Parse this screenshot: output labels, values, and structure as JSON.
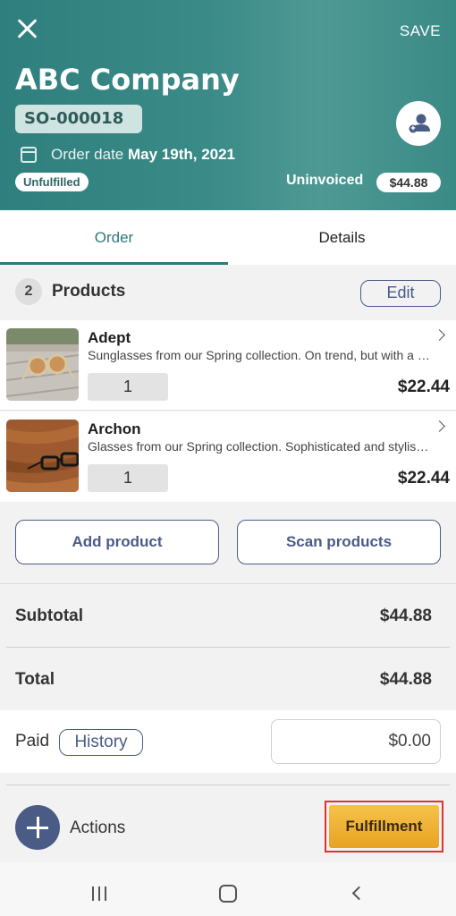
{
  "header": {
    "company": "ABC Company",
    "order_number": "SO-000018",
    "order_date_label": "Order date",
    "order_date_value": "May 19th, 2021",
    "status_badge": "Unfulfilled",
    "invoice_status": "Uninvoiced",
    "invoice_amount": "$44.88",
    "save_label": "SAVE"
  },
  "tabs": [
    {
      "label": "Order",
      "active": true
    },
    {
      "label": "Details",
      "active": false
    }
  ],
  "products_section": {
    "count": "2",
    "title": "Products",
    "edit_label": "Edit"
  },
  "products": [
    {
      "name": "Adept",
      "description": "Sunglasses from our Spring collection. On trend, but with a classic silhouette.",
      "quantity": "1",
      "price": "$22.44",
      "thumbnail": "round-sunglasses-on-wooden-deck"
    },
    {
      "name": "Archon",
      "description": "Glasses from our Spring collection. Sophisticated and stylish frames.",
      "quantity": "1",
      "price": "$22.44",
      "thumbnail": "black-glasses-on-wooden-table"
    }
  ],
  "actions_row": {
    "add_product": "Add product",
    "scan_products": "Scan products"
  },
  "totals": {
    "subtotal_label": "Subtotal",
    "subtotal_value": "$44.88",
    "total_label": "Total",
    "total_value": "$44.88"
  },
  "payment": {
    "paid_label": "Paid",
    "history_label": "History",
    "paid_value": "$0.00"
  },
  "footer": {
    "actions_label": "Actions",
    "fulfillment_label": "Fulfillment"
  },
  "colors": {
    "header_teal": "#3a8a87",
    "accent_navy": "#4a5b86",
    "fulfillment_gold": "#f0b035",
    "highlight_red": "#e03232"
  }
}
